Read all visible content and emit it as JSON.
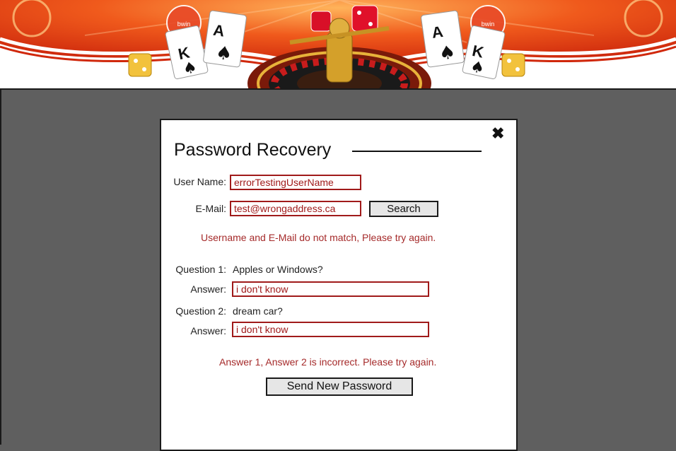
{
  "banner": {
    "brand_mark": "bwin"
  },
  "dialog": {
    "title": "Password Recovery",
    "close_glyph": "✖",
    "username": {
      "label": "User Name:",
      "value": "errorTestingUserName"
    },
    "email": {
      "label": "E-Mail:",
      "value": "test@wrongaddress.ca"
    },
    "search_button": "Search",
    "match_error": "Username and E-Mail do not match, Please try again.",
    "question1": {
      "label": "Question 1:",
      "text": "Apples or Windows?",
      "answer_label": "Answer:",
      "answer_value": "i don't know"
    },
    "question2": {
      "label": "Question 2:",
      "text": "dream car?",
      "answer_label": "Answer:",
      "answer_value": "i don't know"
    },
    "answer_error": "Answer 1, Answer 2 is incorrect. Please try again.",
    "send_button": "Send New Password"
  },
  "colors": {
    "error": "#a52a2a",
    "field_border": "#a01a1a",
    "overlay": "#5f5f5f",
    "banner_red": "#e53a12"
  }
}
